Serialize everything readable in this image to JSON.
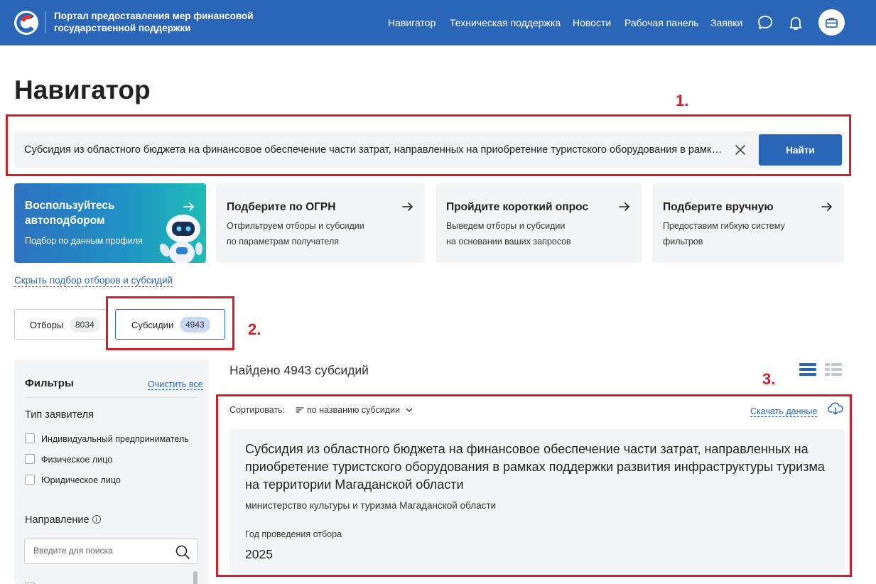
{
  "header": {
    "brand": "Портал предоставления мер финансовой государственной поддержки",
    "nav": [
      "Навигатор",
      "Техническая поддержка",
      "Новости",
      "Рабочая панель",
      "Заявки"
    ],
    "icons": [
      "chat-icon",
      "bell-icon",
      "briefcase-icon"
    ],
    "brand_color": "#2a66b8"
  },
  "page": {
    "title": "Навигатор"
  },
  "annotations": {
    "n1": "1.",
    "n2": "2.",
    "n3": "3.",
    "color": "#d0202a"
  },
  "search": {
    "value": "Субсидия из областного бюджета на финансовое обеспечение части затрат, направленных на приобретение туристского оборудования в рамках поддержки развития инфраструктуры туризма на территории Магаданской области",
    "button": "Найти"
  },
  "cards": [
    {
      "title": "Воспользуйтесь автоподбором",
      "desc": "Подбор по данным профиля"
    },
    {
      "title": "Подберите по ОГРН",
      "desc": "Отфильтруем отборы и субсидии\nпо параметрам получателя"
    },
    {
      "title": "Пройдите короткий опрос",
      "desc": "Выведем отборы и субсидии\nна основании ваших запросов"
    },
    {
      "title": "Подберите вручную",
      "desc": "Предоставим гибкую систему\nфильтров"
    }
  ],
  "hide_link": "Скрыть подбор отборов и субсидий",
  "tabs": [
    {
      "label": "Отборы",
      "count": "8034"
    },
    {
      "label": "Субсидии",
      "count": "4943"
    }
  ],
  "filters": {
    "title": "Фильтры",
    "clear": "Очистить все",
    "applicant_type": {
      "title": "Тип заявителя",
      "options": [
        "Индивидуальный предприниматель",
        "Физическое лицо",
        "Юридическое лицо"
      ]
    },
    "direction": {
      "title": "Направление",
      "info": "i",
      "placeholder": "Введите для поиска"
    }
  },
  "results": {
    "found": "Найдено 4943 субсидий",
    "sort_label": "Сортировать:",
    "sort_value": "по названию субсидии",
    "download": "Скачать данные",
    "items": [
      {
        "title": "Субсидия из областного бюджета на финансовое обеспечение части затрат, направленных на приобретение туристского оборудования в рамках поддержки развития инфраструктуры туризма на территории Магаданской области",
        "org": "министерство культуры и туризма Магаданской области",
        "year_label": "Год проведения отбора",
        "year": "2025"
      }
    ]
  }
}
